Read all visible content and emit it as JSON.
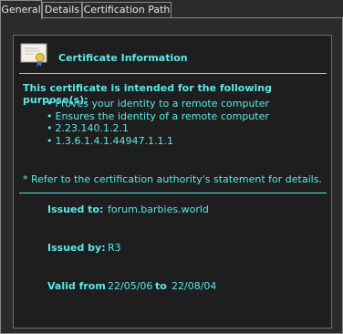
{
  "tabs": [
    {
      "label": "General"
    },
    {
      "label": "Details"
    },
    {
      "label": "Certification Path"
    }
  ],
  "header": {
    "icon": "certificate-icon",
    "title": "Certificate Information"
  },
  "purpose": {
    "title": "This certificate is intended for the following purpose(s):",
    "items": [
      "Proves your identity to a remote computer",
      "Ensures the identity of a remote computer",
      "2.23.140.1.2.1",
      "1.3.6.1.4.1.44947.1.1.1"
    ],
    "note": "* Refer to the certification authority's statement for details."
  },
  "fields": {
    "issued_to_label": "Issued to:",
    "issued_to_value": "forum.barbies.world",
    "issued_by_label": "Issued by:",
    "issued_by_value": "R3",
    "valid_from_label": "Valid from",
    "valid_from_value": "22/05/06",
    "to_label": "to",
    "valid_to_value": "22/08/04"
  },
  "colors": {
    "accent": "#5ee6e6",
    "background": "#2b2b2b",
    "box": "#1e1e1e"
  }
}
